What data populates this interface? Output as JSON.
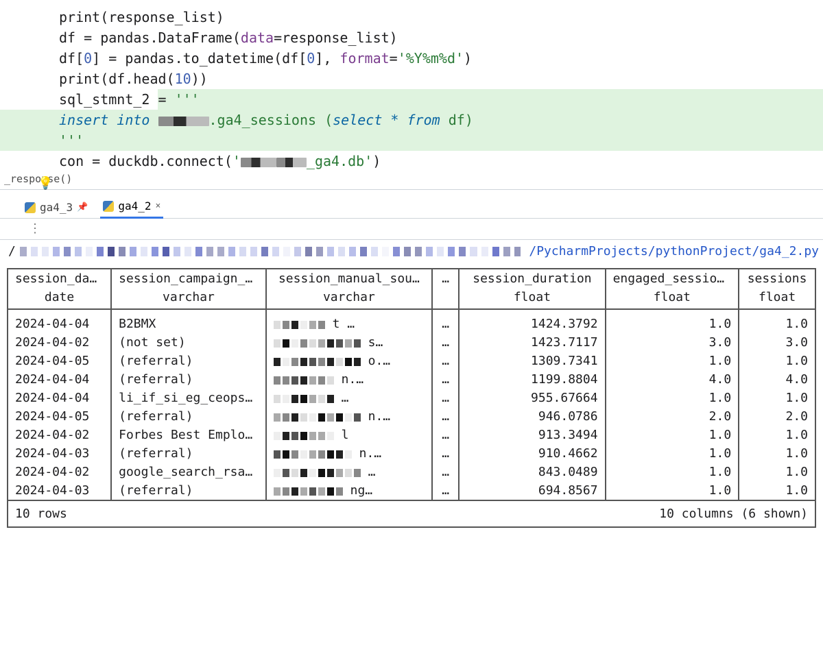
{
  "editor": {
    "lines": [
      {
        "cls": "",
        "segs": [
          [
            "fn",
            "print"
          ],
          [
            "",
            "(response_list)"
          ]
        ]
      },
      {
        "cls": "",
        "segs": [
          [
            "",
            ""
          ]
        ]
      },
      {
        "cls": "",
        "segs": [
          [
            "",
            "df = pandas.DataFrame("
          ],
          [
            "id",
            "data"
          ],
          [
            "",
            "=response_list)"
          ]
        ]
      },
      {
        "cls": "",
        "segs": [
          [
            "",
            "df["
          ],
          [
            "num",
            "0"
          ],
          [
            "",
            "] = pandas.to_datetime(df["
          ],
          [
            "num",
            "0"
          ],
          [
            "",
            "], "
          ],
          [
            "id",
            "format"
          ],
          [
            "",
            "="
          ],
          [
            "str",
            "'%Y%m%d'"
          ],
          [
            "",
            ")"
          ]
        ]
      },
      {
        "cls": "",
        "segs": [
          [
            "fn",
            "print"
          ],
          [
            "",
            "(df.head("
          ],
          [
            "num",
            "10"
          ],
          [
            "",
            "))"
          ]
        ]
      },
      {
        "cls": "",
        "segs": [
          [
            "",
            ""
          ]
        ]
      },
      {
        "cls": "hl first",
        "segs": [
          [
            "",
            "sql_stmnt_2 = "
          ],
          [
            "str",
            "'''"
          ]
        ]
      },
      {
        "cls": "hl",
        "segs": [
          [
            "kw",
            "insert into "
          ],
          [
            "redact",
            "r1"
          ],
          [
            "str",
            ".ga4_sessions ("
          ],
          [
            "kw",
            "select "
          ],
          [
            "kw2",
            "* "
          ],
          [
            "kw",
            "from "
          ],
          [
            "str",
            "df)"
          ]
        ]
      },
      {
        "cls": "hl",
        "segs": [
          [
            "str",
            "'''"
          ]
        ]
      },
      {
        "cls": "",
        "segs": [
          [
            "",
            "con = duckdb.connect("
          ],
          [
            "str",
            "'"
          ],
          [
            "redact",
            "r2"
          ],
          [
            "redact",
            "r3"
          ],
          [
            "str",
            "_ga4.db'"
          ],
          [
            "",
            ")"
          ]
        ]
      }
    ],
    "breadcrumb": "_response()"
  },
  "tabs": [
    {
      "name": "ga4_3",
      "pinned": true,
      "active": false
    },
    {
      "name": "ga4_2",
      "pinned": false,
      "active": true
    }
  ],
  "minibar": "⋮",
  "path": {
    "prefix": "/",
    "link": "/PycharmProjects/pythonProject/ga4_2.py"
  },
  "table": {
    "headers": [
      "session_date",
      "session_campaign_n…",
      "session_manual_sou…",
      "…",
      "session_duration",
      "engaged_sessions",
      "sessions"
    ],
    "types": [
      "date",
      "varchar",
      "varchar",
      "",
      "float",
      "float",
      "float"
    ],
    "rows": [
      {
        "d": "2024-04-04",
        "camp": "B2BMX",
        "src_tail": "t …",
        "dur": "1424.3792",
        "eng": "1.0",
        "ses": "1.0"
      },
      {
        "d": "2024-04-02",
        "camp": "(not set)",
        "src_tail": "s…",
        "dur": "1423.7117",
        "eng": "3.0",
        "ses": "3.0"
      },
      {
        "d": "2024-04-05",
        "camp": "(referral)",
        "src_tail": "o.…",
        "dur": "1309.7341",
        "eng": "1.0",
        "ses": "1.0"
      },
      {
        "d": "2024-04-04",
        "camp": "(referral)",
        "src_tail": "n.…",
        "dur": "1199.8804",
        "eng": "4.0",
        "ses": "4.0"
      },
      {
        "d": "2024-04-04",
        "camp": "li_if_si_eg_ceops_…",
        "src_tail": "…",
        "dur": "955.67664",
        "eng": "1.0",
        "ses": "1.0"
      },
      {
        "d": "2024-04-05",
        "camp": "(referral)",
        "src_tail": "n.…",
        "dur": "946.0786",
        "eng": "2.0",
        "ses": "2.0"
      },
      {
        "d": "2024-04-02",
        "camp": "Forbes Best Employer",
        "src_tail": "l",
        "dur": "913.3494",
        "eng": "1.0",
        "ses": "1.0"
      },
      {
        "d": "2024-04-03",
        "camp": "(referral)",
        "src_tail": "n.…",
        "dur": "910.4662",
        "eng": "1.0",
        "ses": "1.0"
      },
      {
        "d": "2024-04-02",
        "camp": "google_search_rsa_…",
        "src_tail": "…",
        "dur": "843.0489",
        "eng": "1.0",
        "ses": "1.0"
      },
      {
        "d": "2024-04-03",
        "camp": "(referral)",
        "src_tail": "ng…",
        "dur": "694.8567",
        "eng": "1.0",
        "ses": "1.0"
      }
    ],
    "footer_left": "10 rows",
    "footer_right": "10 columns (6 shown)"
  }
}
